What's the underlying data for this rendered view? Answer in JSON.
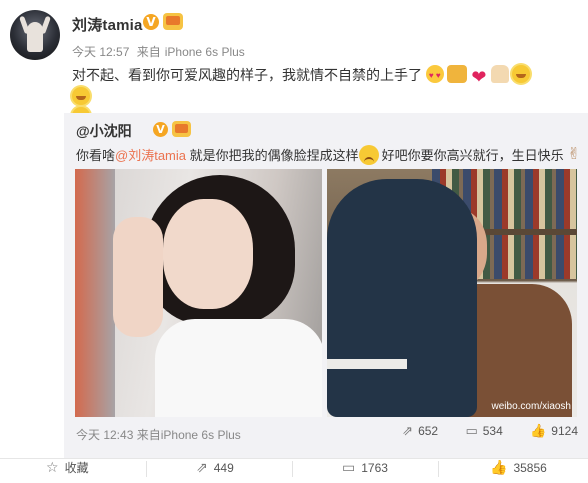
{
  "post": {
    "username": "刘涛tamia",
    "verified_badge": "V",
    "time": "今天 12:57",
    "source_prefix": "来自",
    "source": "iPhone 6s Plus",
    "text": "对不起、看到你可爱风趣的样子，我就情不自禁的上手了",
    "emojis": [
      "heart-eyes",
      "cheers",
      "heart",
      "clap",
      "sun",
      "sun",
      "sun"
    ]
  },
  "repost": {
    "username": "@小沈阳",
    "verified_badge": "V",
    "text_before": "你看啥",
    "mention": "@刘涛tamia",
    "text_mid": " 就是你把我的偶像脸捏成这样",
    "text_after": "好吧你要你高兴就行，生日快乐",
    "watermark": "weibo.com/xiaosh",
    "time": "今天 12:43",
    "source_prefix": "来自",
    "source": "iPhone 6s Plus",
    "repost_count": "652",
    "comment_count": "534",
    "like_count": "9124"
  },
  "actions": {
    "favorite_label": "收藏",
    "repost_count": "449",
    "comment_count": "1763",
    "like_count": "35856"
  }
}
